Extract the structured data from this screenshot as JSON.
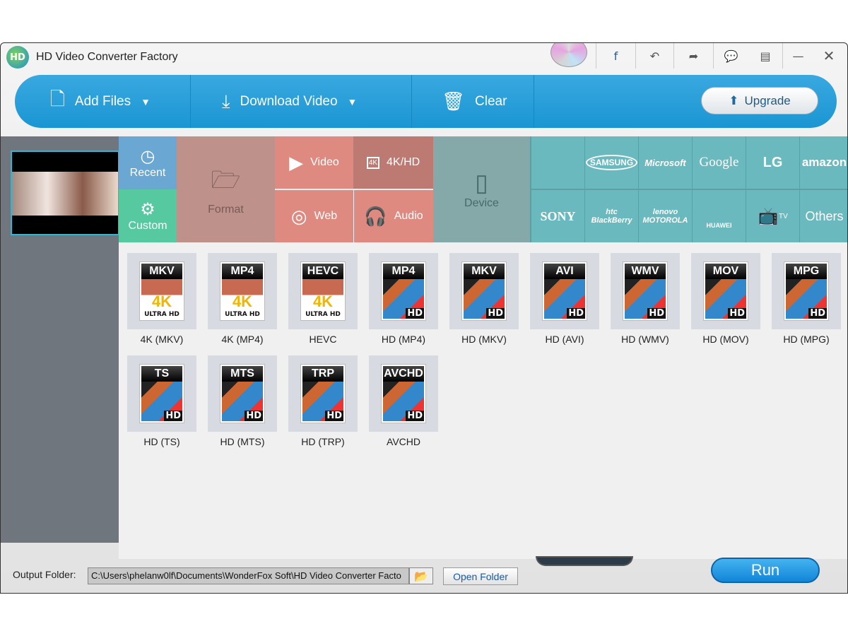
{
  "window": {
    "title": "HD Video Converter Factory",
    "logo_text": "HD"
  },
  "title_icons": [
    "disc-icon",
    "facebook-icon",
    "undo-icon",
    "share-icon",
    "chat-icon",
    "register-icon",
    "minimize-icon",
    "close-icon"
  ],
  "toolbar": {
    "add_files": "Add Files",
    "download_video": "Download Video",
    "clear": "Clear",
    "upgrade": "Upgrade"
  },
  "categories": {
    "recent": "Recent",
    "custom": "Custom",
    "format": "Format",
    "video": "Video",
    "k4hd": "4K/HD",
    "web": "Web",
    "audio": "Audio",
    "device": "Device"
  },
  "brands": {
    "row1": [
      "",
      "SAMSUNG",
      "Microsoft",
      "Google",
      "LG",
      "amazon"
    ],
    "row2": [
      "SONY",
      "htc BlackBerry",
      "lenovo MOTOROLA",
      "HUAWEI",
      "TV",
      "Others"
    ]
  },
  "colors": {
    "recent": "#6ba7d3",
    "custom": "#57c9a0",
    "format": "#bf918b",
    "video": "#df8a80",
    "k4hd": "#bd7a73",
    "device": "#84a9a8",
    "brand": "#6ab9bf",
    "toolbar": "#1f9bd6"
  },
  "formats": [
    {
      "tag": "MKV",
      "label": "4K (MKV)",
      "kind": "4k"
    },
    {
      "tag": "MP4",
      "label": "4K (MP4)",
      "kind": "4k"
    },
    {
      "tag": "HEVC",
      "label": "HEVC",
      "kind": "4k"
    },
    {
      "tag": "MP4",
      "label": "HD (MP4)",
      "kind": "hd"
    },
    {
      "tag": "MKV",
      "label": "HD (MKV)",
      "kind": "hd"
    },
    {
      "tag": "AVI",
      "label": "HD (AVI)",
      "kind": "hd"
    },
    {
      "tag": "WMV",
      "label": "HD (WMV)",
      "kind": "hd"
    },
    {
      "tag": "MOV",
      "label": "HD (MOV)",
      "kind": "hd"
    },
    {
      "tag": "MPG",
      "label": "HD (MPG)",
      "kind": "hd"
    },
    {
      "tag": "TS",
      "label": "HD (TS)",
      "kind": "hd"
    },
    {
      "tag": "MTS",
      "label": "HD (MTS)",
      "kind": "hd"
    },
    {
      "tag": "TRP",
      "label": "HD (TRP)",
      "kind": "hd"
    },
    {
      "tag": "AVCHD",
      "label": "AVCHD",
      "kind": "hd"
    }
  ],
  "badges": {
    "k4": "4K",
    "ultra": "ULTRA HD",
    "hd": "HD"
  },
  "bottom": {
    "output_label": "Output Folder:",
    "output_path": "C:\\Users\\phelanw0lf\\Documents\\WonderFox Soft\\HD Video Converter Facto",
    "open_folder": "Open Folder",
    "run": "Run"
  }
}
